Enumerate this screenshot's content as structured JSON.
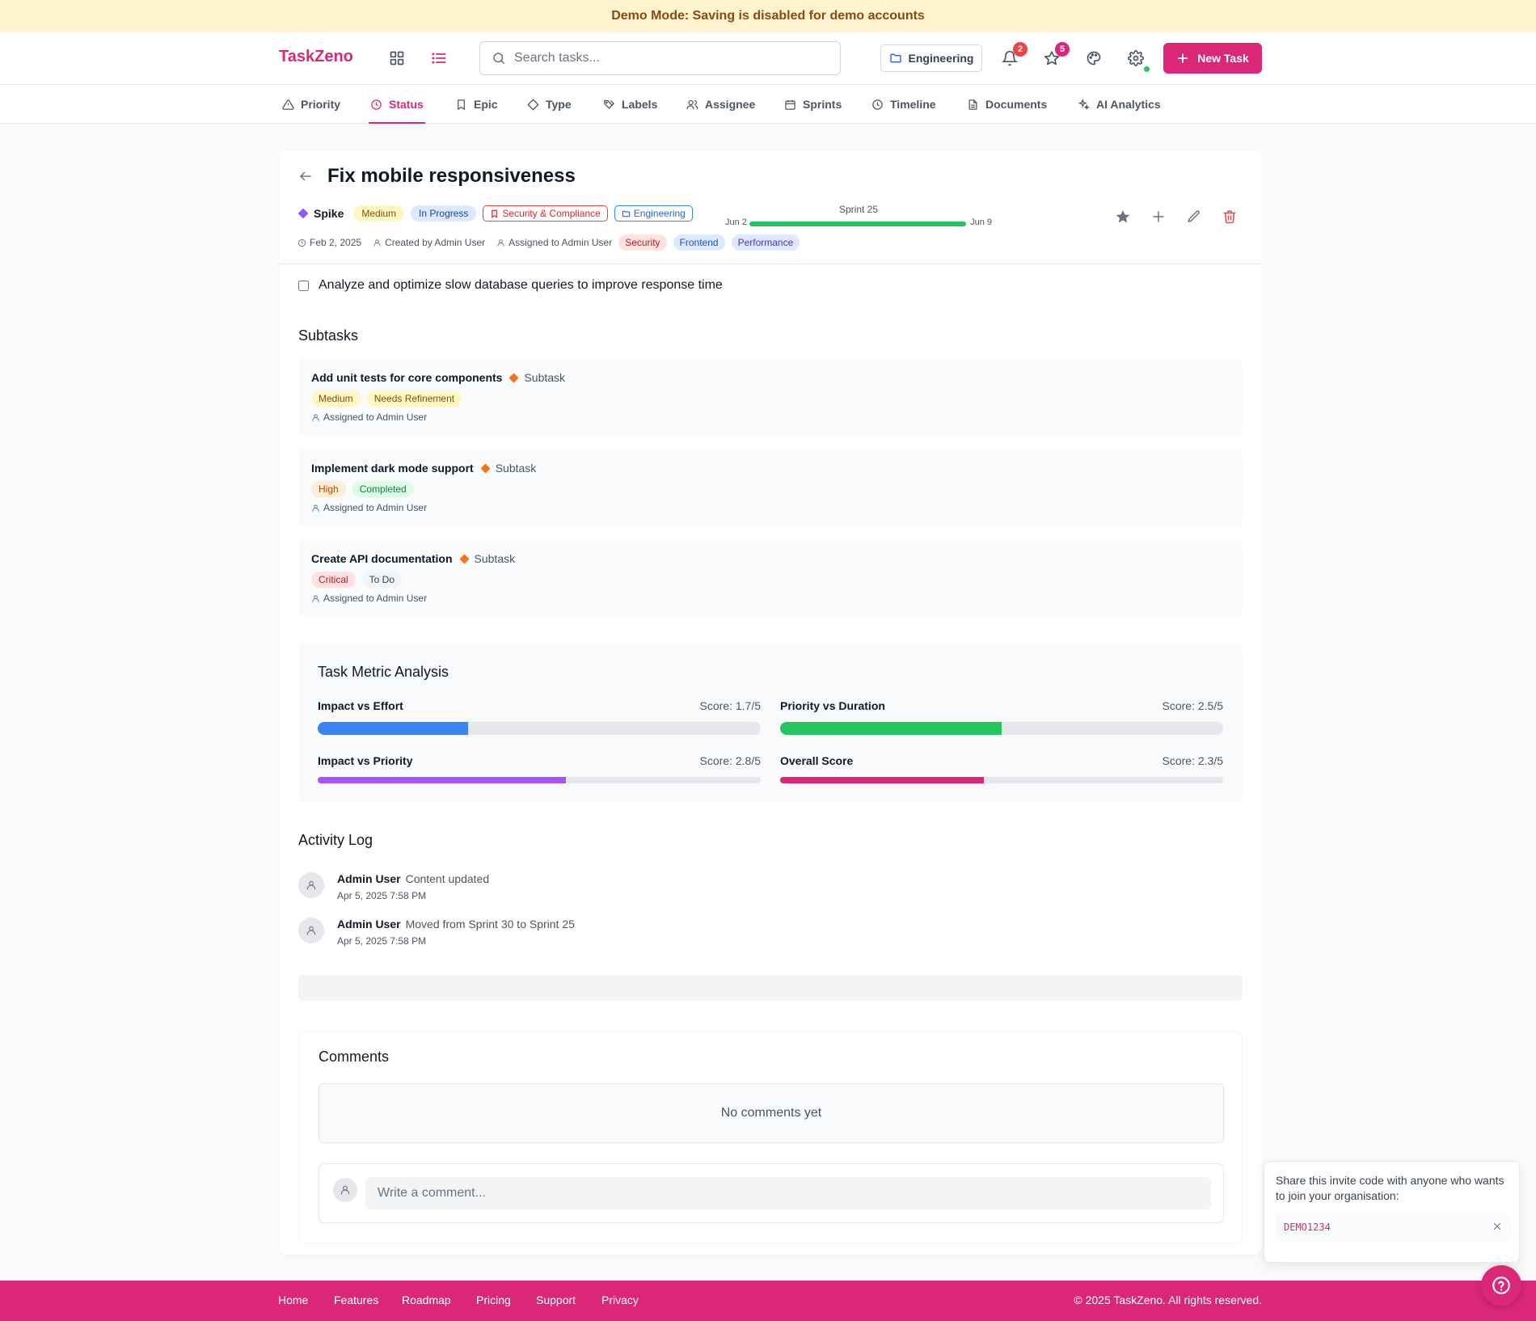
{
  "banner": {
    "text": "Demo Mode: Saving is disabled for demo accounts"
  },
  "header": {
    "brand": "TaskZeno",
    "search_placeholder": "Search tasks...",
    "org_label": "Engineering",
    "notifications_count": "2",
    "favorites_count": "5",
    "new_task_label": "New Task"
  },
  "tabs": [
    {
      "label": "Priority",
      "icon": "alert-triangle-icon"
    },
    {
      "label": "Status",
      "icon": "clock-icon",
      "active": true
    },
    {
      "label": "Epic",
      "icon": "bookmark-icon"
    },
    {
      "label": "Type",
      "icon": "diamond-icon"
    },
    {
      "label": "Labels",
      "icon": "tags-icon"
    },
    {
      "label": "Assignee",
      "icon": "users-icon"
    },
    {
      "label": "Sprints",
      "icon": "calendar-icon"
    },
    {
      "label": "Timeline",
      "icon": "clock-icon"
    },
    {
      "label": "Documents",
      "icon": "file-icon"
    },
    {
      "label": "AI Analytics",
      "icon": "sparkles-icon"
    }
  ],
  "task": {
    "title": "Fix mobile responsiveness",
    "type": "Spike",
    "priority": "Medium",
    "status": "In Progress",
    "epic": "Security & Compliance",
    "project": "Engineering",
    "sprint": {
      "name": "Sprint 25",
      "start": "Jun 2",
      "end": "Jun 9",
      "progress": 1.0
    },
    "date": "Feb 2, 2025",
    "created_by": "Created by Admin User",
    "assigned_to": "Assigned to Admin User",
    "labels": [
      "Security",
      "Frontend",
      "Performance"
    ],
    "description": "Analyze and optimize slow database queries to improve response time"
  },
  "subtasks_title": "Subtasks",
  "subtasks": [
    {
      "title": "Add unit tests for core components",
      "type": "Subtask",
      "priority": "Medium",
      "status": "Needs Refinement",
      "assigned": "Assigned to Admin User"
    },
    {
      "title": "Implement dark mode support",
      "type": "Subtask",
      "priority": "High",
      "status": "Completed",
      "assigned": "Assigned to Admin User"
    },
    {
      "title": "Create API documentation",
      "type": "Subtask",
      "priority": "Critical",
      "status": "To Do",
      "assigned": "Assigned to Admin User"
    }
  ],
  "metrics": {
    "title": "Task Metric Analysis",
    "items": [
      {
        "name": "Impact vs Effort",
        "score": "Score: 1.7/5",
        "value": 1.7,
        "max": 5,
        "color": "#3b82f6"
      },
      {
        "name": "Priority vs Duration",
        "score": "Score: 2.5/5",
        "value": 2.5,
        "max": 5,
        "color": "#22c55e"
      },
      {
        "name": "Impact vs Priority",
        "score": "Score: 2.8/5",
        "value": 2.8,
        "max": 5,
        "color": "#a855f7"
      },
      {
        "name": "Overall Score",
        "score": "Score: 2.3/5",
        "value": 2.3,
        "max": 5,
        "color": "#db2777"
      }
    ]
  },
  "activity": {
    "title": "Activity Log",
    "entries": [
      {
        "user": "Admin User",
        "text": "Content updated",
        "time": "Apr 5, 2025 7:58 PM"
      },
      {
        "user": "Admin User",
        "text": "Moved from Sprint 30 to Sprint 25",
        "time": "Apr 5, 2025 7:58 PM"
      }
    ]
  },
  "comments": {
    "title": "Comments",
    "empty_text": "No comments yet",
    "placeholder": "Write a comment..."
  },
  "invite": {
    "text": "Share this invite code with anyone who wants to join your organisation:",
    "code": "DEMO1234"
  },
  "footer": {
    "links": [
      "Home",
      "Features",
      "Roadmap",
      "Pricing",
      "Support",
      "Privacy"
    ],
    "copyright": "© 2025 TaskZeno. All rights reserved."
  },
  "colors": {
    "brand": "#db2777",
    "banner_bg": "#fdf3cf"
  }
}
